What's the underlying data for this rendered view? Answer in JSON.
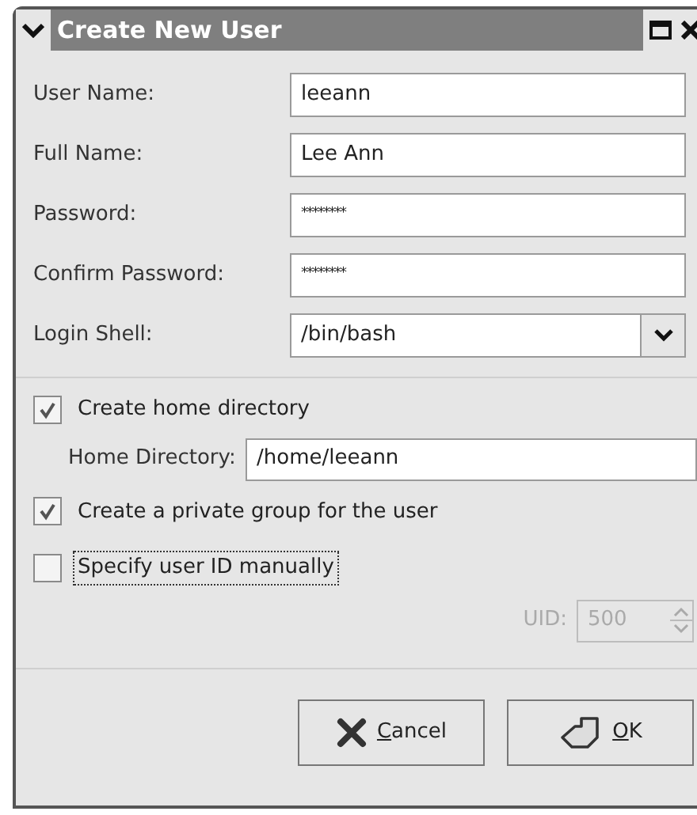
{
  "window": {
    "title": "Create New User"
  },
  "fields": [
    {
      "label": "User Name:",
      "value": "leeann",
      "kind": "text"
    },
    {
      "label": "Full Name:",
      "value": "Lee Ann",
      "kind": "text"
    },
    {
      "label": "Password:",
      "value": "********",
      "kind": "password"
    },
    {
      "label": "Confirm Password:",
      "value": "********",
      "kind": "password"
    },
    {
      "label": "Login Shell:",
      "value": "/bin/bash",
      "kind": "dropdown"
    }
  ],
  "create_home": {
    "label": "Create home directory",
    "checked": true
  },
  "home_directory": {
    "label": "Home Directory:",
    "value": "/home/leeann"
  },
  "private_group": {
    "label": "Create a private group for the user",
    "checked": true
  },
  "specify_uid": {
    "label": "Specify user ID manually",
    "checked": false,
    "focused": true
  },
  "uid": {
    "label": "UID:",
    "value": "500",
    "disabled": true
  },
  "buttons": [
    {
      "label": "Cancel",
      "kind": "cancel"
    },
    {
      "label": "OK",
      "kind": "ok"
    }
  ]
}
